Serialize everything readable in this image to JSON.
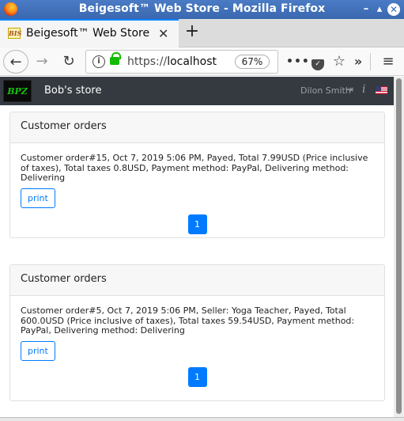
{
  "window": {
    "title": "Beigesoft™ Web Store - Mozilla Firefox",
    "min_glyph": "–",
    "max_glyph": "▴",
    "close_glyph": "✕"
  },
  "tab": {
    "title": "Beigesoft™ Web Store",
    "favicon_text": "BIS",
    "close_glyph": "✕",
    "new_tab_glyph": "+"
  },
  "nav": {
    "back_glyph": "←",
    "forward_glyph": "→",
    "reload_glyph": "↻",
    "url_scheme": "https://",
    "url_host": "localhost",
    "zoom": "67%",
    "more_glyph": "•••",
    "star_glyph": "☆",
    "overflow_glyph": "»",
    "menu_glyph": "≡"
  },
  "store": {
    "logo_text": "BPZ",
    "name": "Bob's store",
    "user": "Dilon Smith",
    "logout_glyph": "⇥",
    "info_glyph": "i"
  },
  "orders": [
    {
      "header": "Customer orders",
      "text": "Customer order#15, Oct 7, 2019 5:06 PM, Payed, Total 7.99USD (Price inclusive of taxes), Total taxes 0.8USD, Payment method: PayPal, Delivering method: Delivering",
      "print_label": "print",
      "page": "1"
    },
    {
      "header": "Customer orders",
      "text": "Customer order#5, Oct 7, 2019 5:06 PM, Seller: Yoga Teacher, Payed, Total 600.0USD (Price inclusive of taxes), Total taxes 59.54USD, Payment method: PayPal, Delivering method: Delivering",
      "print_label": "print",
      "page": "1"
    }
  ],
  "colors": {
    "title_bar": "#3a68b0",
    "store_bar": "#343a40",
    "accent": "#007bff",
    "secure_lock": "#12bc00"
  }
}
